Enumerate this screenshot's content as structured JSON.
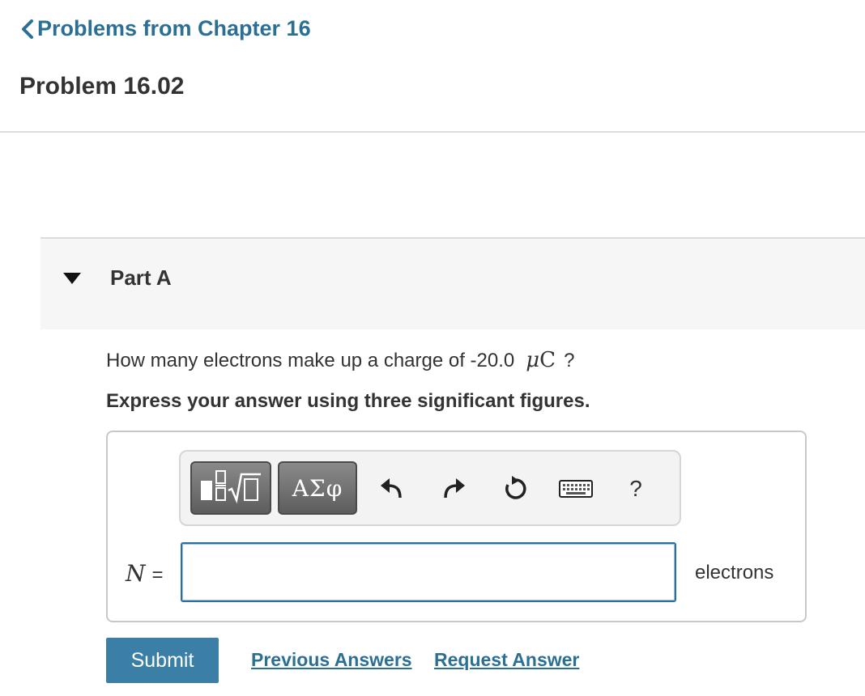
{
  "nav": {
    "back_label": "Problems from Chapter 16"
  },
  "problem": {
    "title": "Problem 16.02"
  },
  "part": {
    "label": "Part A"
  },
  "question": {
    "text_before": "How many electrons make up a charge of -20.0",
    "unit_prefix": "μ",
    "unit_symbol": "C",
    "text_after": "?"
  },
  "instructions": "Express your answer using three significant figures.",
  "toolbar": {
    "greek_label": "ΑΣφ",
    "help_label": "?"
  },
  "answer": {
    "variable": "N",
    "equals": "=",
    "value": "",
    "units": "electrons"
  },
  "actions": {
    "submit_label": "Submit",
    "previous_answers_label": "Previous Answers",
    "request_answer_label": "Request Answer"
  },
  "colors": {
    "link": "#2b7094",
    "submit_bg": "#3b7fa6",
    "input_border": "#2b6f9c"
  }
}
